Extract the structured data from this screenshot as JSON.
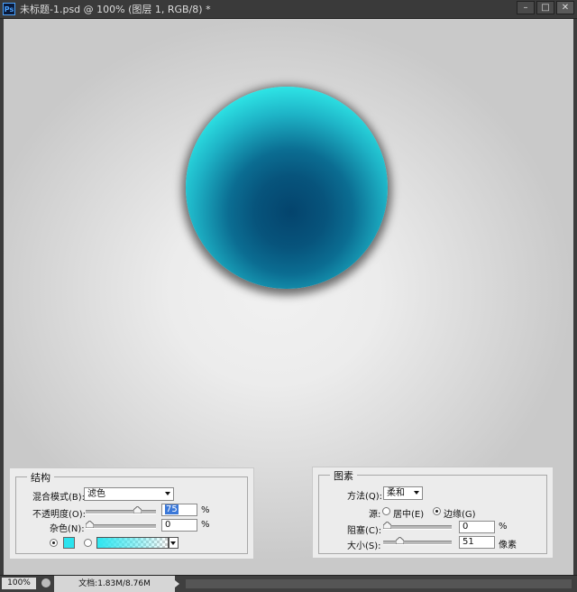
{
  "window": {
    "app_icon": "Ps",
    "title": "未标题-1.psd @ 100% (图层 1, RGB/8) *",
    "buttons": {
      "minimize": "–",
      "restore": "□",
      "close": "✕"
    }
  },
  "canvas": {
    "colors": {
      "ball_outer": "#2ff5ea",
      "ball_inner": "#04446d",
      "background": "#ececec"
    }
  },
  "structure_panel": {
    "title": "结构",
    "blend_mode_label": "混合模式(B):",
    "blend_mode_value": "滤色",
    "opacity_label": "不透明度(O):",
    "opacity_value": "75",
    "opacity_unit": "%",
    "noise_label": "杂色(N):",
    "noise_value": "0",
    "noise_unit": "%",
    "color_swatch": "#2be3ee",
    "mode": "solid-color"
  },
  "elements_panel": {
    "title": "图素",
    "technique_label": "方法(Q):",
    "technique_value": "柔和",
    "source_label": "源:",
    "source_center_label": "居中(E)",
    "source_edge_label": "边缘(G)",
    "source_selected": "edge",
    "choke_label": "阻塞(C):",
    "choke_value": "0",
    "choke_unit": "%",
    "size_label": "大小(S):",
    "size_value": "51",
    "size_unit": "像素"
  },
  "statusbar": {
    "zoom": "100%",
    "doc_info": "文档:1.83M/8.76M"
  }
}
